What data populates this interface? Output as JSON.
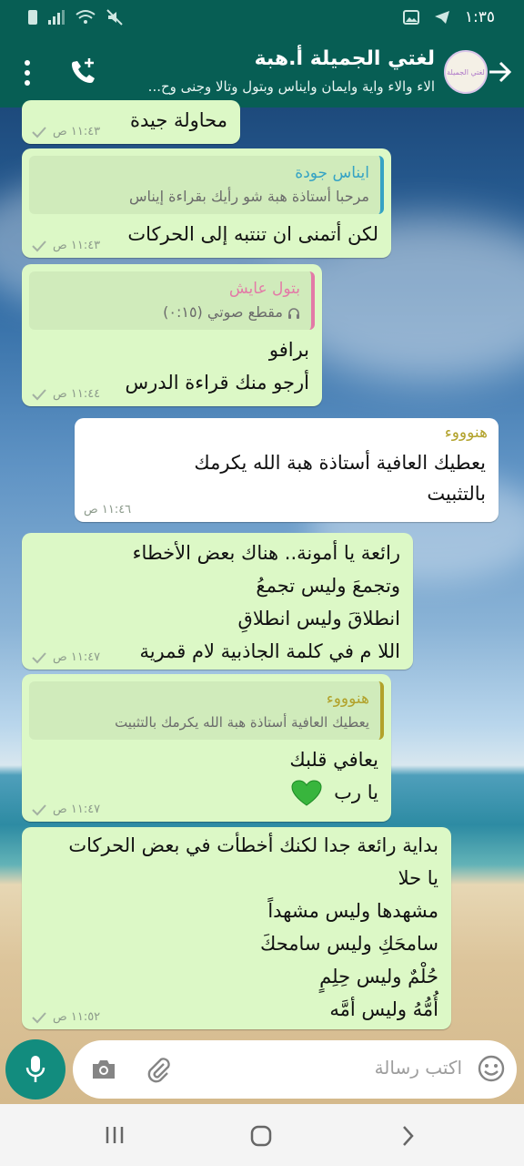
{
  "status_bar": {
    "time": "١:٣٥"
  },
  "header": {
    "title": "لغتي الجميلة أ.هبة",
    "subtitle": "الاء والاء واية وايمان وايناس وبتول وتالا وجنى وح...",
    "avatar_text": "لغتي الجميلة"
  },
  "messages": [
    {
      "type": "in",
      "lines": [
        "محاولة جيدة"
      ],
      "time": "١١:٤٣ ص"
    },
    {
      "type": "in",
      "quote": {
        "author": "ايناس جودة",
        "author_color": "#35a3c4",
        "text": "مرحبا أستاذة هبة شو رأيك بقراءة إيناس"
      },
      "lines": [
        "لكن أتمنى ان تنتبه إلى الحركات"
      ],
      "time": "١١:٤٣ ص"
    },
    {
      "type": "in",
      "quote": {
        "author": "بتول عايش",
        "author_color": "#e37aa7",
        "text": "مقطع صوتي (٠:١٥)"
      },
      "lines": [
        "برافو",
        "أرجو منك قراءة الدرس"
      ],
      "time": "١١:٤٤ ص"
    },
    {
      "type": "out",
      "sender": "هنوووء",
      "sender_color": "#b2a22b",
      "lines": [
        "يعطيك العافية أستاذة هبة    الله يكرمك",
        "بالتثبيت"
      ],
      "time": "١١:٤٦ ص"
    },
    {
      "type": "in",
      "lines": [
        "رائعة يا أمونة.. هناك بعض الأخطاء",
        "وتجمعَ وليس تجمعُ",
        "انطلاقَ وليس انطلاقِ",
        "اللا م في كلمة الجاذبية لام قمرية"
      ],
      "time": "١١:٤٧ ص"
    },
    {
      "type": "in",
      "quote": {
        "author": "هنوووء",
        "author_color": "#b2a22b",
        "text": "يعطيك العافية أستاذة هبة    الله يكرمك بالتثبيت"
      },
      "lines": [
        "يعافي قلبك",
        "يا رب"
      ],
      "emoji": "green-heart",
      "time": "١١:٤٧ ص"
    },
    {
      "type": "in",
      "lines": [
        "بداية رائعة جدا لكنك أخطأت في بعض الحركات",
        "يا حلا",
        "مشهدها وليس مشهداً",
        "سامحَكِ وليس سامحكَ",
        "حُلْمٌ وليس حِلِمٍ",
        "أُمُّهُ وليس أمَّه"
      ],
      "time": "١١:٥٢ ص"
    }
  ],
  "input": {
    "placeholder": "اكتب رسالة"
  },
  "colors": {
    "header": "#075e54",
    "bubble_in": "#dcf8c6",
    "bubble_out": "#ffffff",
    "mic": "#128c7e"
  }
}
